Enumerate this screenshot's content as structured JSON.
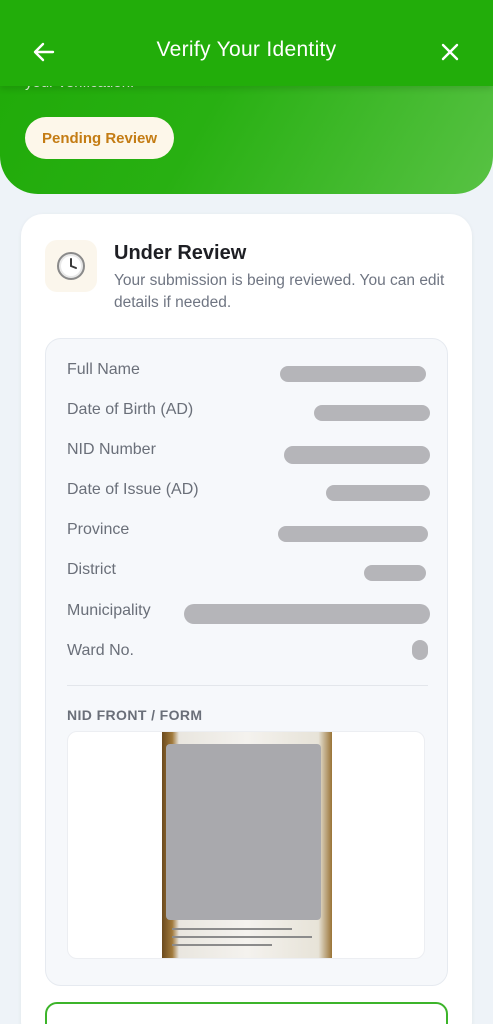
{
  "header": {
    "title": "Verify Your Identity",
    "subtitle_partial": "your verification.",
    "status_badge": "Pending Review",
    "back_icon": "arrow-left-icon",
    "close_icon": "close-icon"
  },
  "review": {
    "icon": "clock-icon",
    "title": "Under Review",
    "description": "Your submission is being reviewed. You can edit details if needed."
  },
  "details": {
    "rows": [
      {
        "label": "Full Name"
      },
      {
        "label": "Date of Birth (AD)"
      },
      {
        "label": "NID Number"
      },
      {
        "label": "Date of Issue (AD)"
      },
      {
        "label": "Province"
      },
      {
        "label": "District"
      },
      {
        "label": "Municipality"
      },
      {
        "label": "Ward No."
      }
    ],
    "nid_section_label": "NID FRONT / FORM"
  },
  "colors": {
    "brand_green": "#22ad0a",
    "badge_text": "#c47c14",
    "badge_bg": "#fdf7ea"
  }
}
